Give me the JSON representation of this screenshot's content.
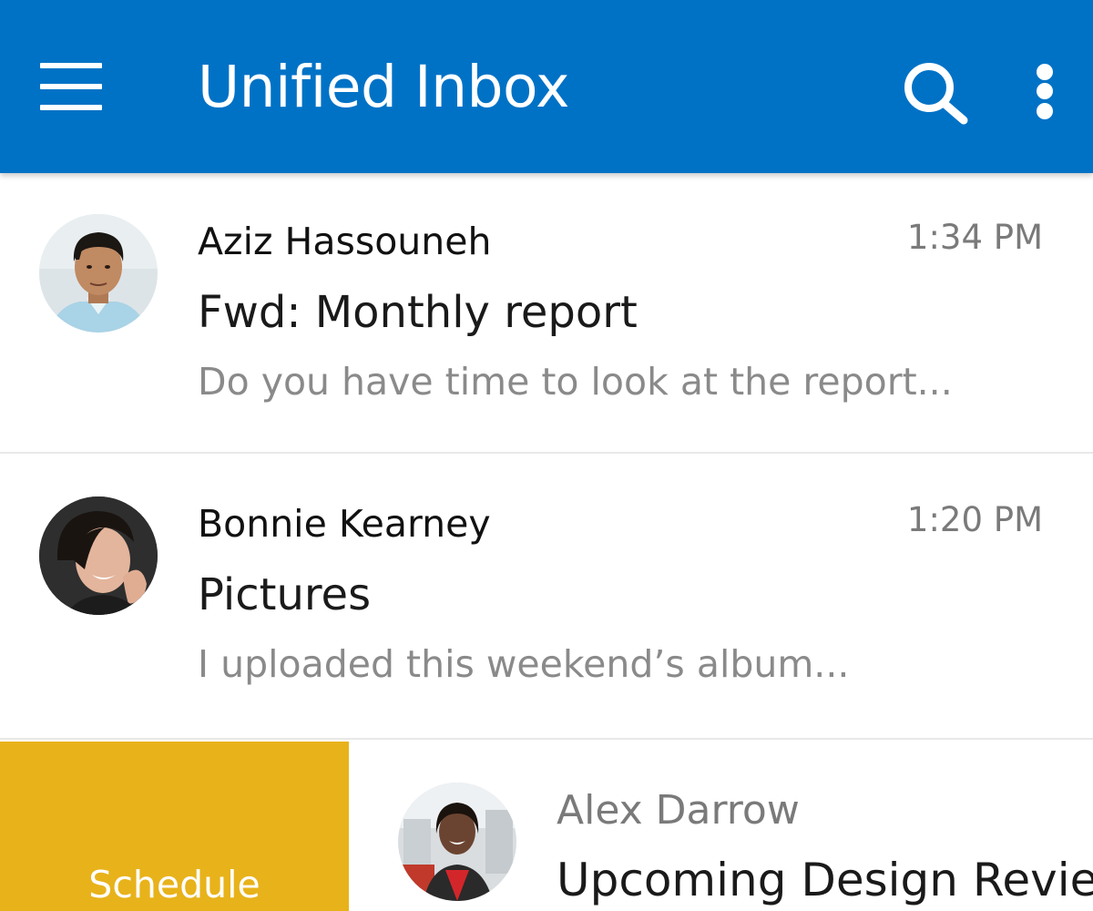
{
  "appbar": {
    "title": "Unified Inbox",
    "background": "#0072c6",
    "menu_icon": "hamburger-menu-icon",
    "search_icon": "search-icon",
    "more_icon": "more-vertical-icon"
  },
  "messages": [
    {
      "sender": "Aziz Hassouneh",
      "time": "1:34 PM",
      "subject": "Fwd: Monthly report",
      "preview": "Do you have time to look at the report..."
    },
    {
      "sender": "Bonnie Kearney",
      "time": "1:20 PM",
      "subject": "Pictures",
      "preview": "I uploaded this weekend’s album..."
    },
    {
      "sender": "Alex Darrow",
      "subject": "Upcoming Design Revie"
    }
  ],
  "swipe_action": {
    "label": "Schedule",
    "color": "#e8b21a"
  }
}
